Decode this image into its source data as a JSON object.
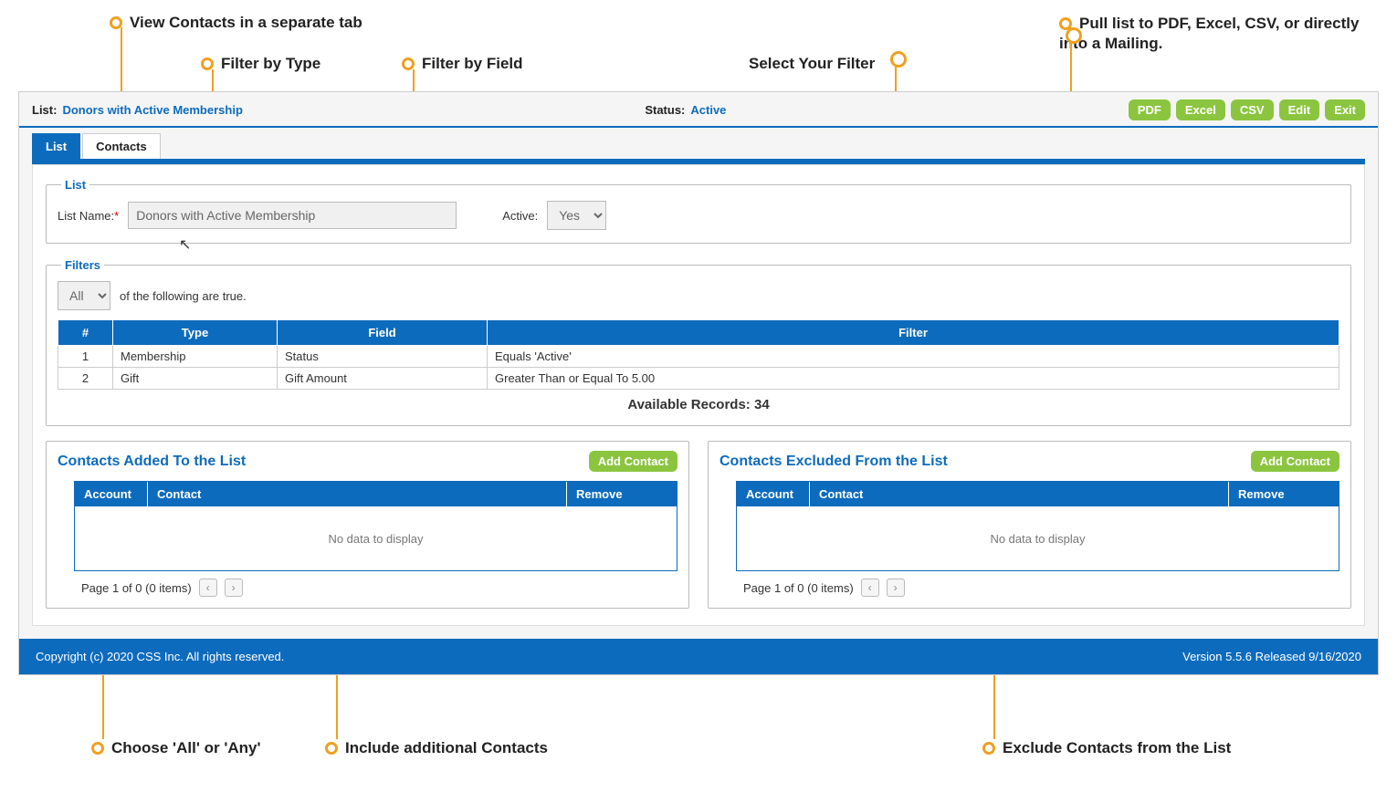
{
  "annotations": {
    "viewContacts": "View Contacts in a separate tab",
    "filterType": "Filter by Type",
    "filterField": "Filter by Field",
    "selectFilter": "Select Your Filter",
    "export": "Pull list to PDF, Excel, CSV, or directly into a Mailing.",
    "chooseAllAny": "Choose 'All' or 'Any'",
    "includeContacts": "Include additional Contacts",
    "excludeContacts": "Exclude Contacts from the List"
  },
  "header": {
    "listLabel": "List:",
    "listName": "Donors with Active Membership",
    "statusLabel": "Status:",
    "statusValue": "Active",
    "buttons": {
      "pdf": "PDF",
      "excel": "Excel",
      "csv": "CSV",
      "edit": "Edit",
      "exit": "Exit"
    }
  },
  "tabs": {
    "list": "List",
    "contacts": "Contacts"
  },
  "listPanel": {
    "legend": "List",
    "nameLabel": "List Name:",
    "required": "*",
    "nameValue": "Donors with Active Membership",
    "activeLabel": "Active:",
    "activeValue": "Yes"
  },
  "filtersPanel": {
    "legend": "Filters",
    "matchSelect": "All",
    "matchText": "of the following are true.",
    "cols": {
      "num": "#",
      "type": "Type",
      "field": "Field",
      "filter": "Filter"
    },
    "rows": [
      {
        "num": "1",
        "type": "Membership",
        "field": "Status",
        "filter": "Equals 'Active'"
      },
      {
        "num": "2",
        "type": "Gift",
        "field": "Gift Amount",
        "filter": "Greater Than or Equal To 5.00"
      }
    ],
    "available": "Available Records: 34"
  },
  "addedPanel": {
    "title": "Contacts Added To the List",
    "addBtn": "Add Contact",
    "cols": {
      "account": "Account",
      "contact": "Contact",
      "remove": "Remove"
    },
    "empty": "No data to display",
    "pager": "Page 1 of 0 (0 items)"
  },
  "excludedPanel": {
    "title": "Contacts Excluded From the List",
    "addBtn": "Add Contact",
    "cols": {
      "account": "Account",
      "contact": "Contact",
      "remove": "Remove"
    },
    "empty": "No data to display",
    "pager": "Page 1 of 0 (0 items)"
  },
  "footer": {
    "copyright": "Copyright (c) 2020 CSS Inc. All rights reserved.",
    "version": "Version 5.5.6 Released 9/16/2020"
  }
}
